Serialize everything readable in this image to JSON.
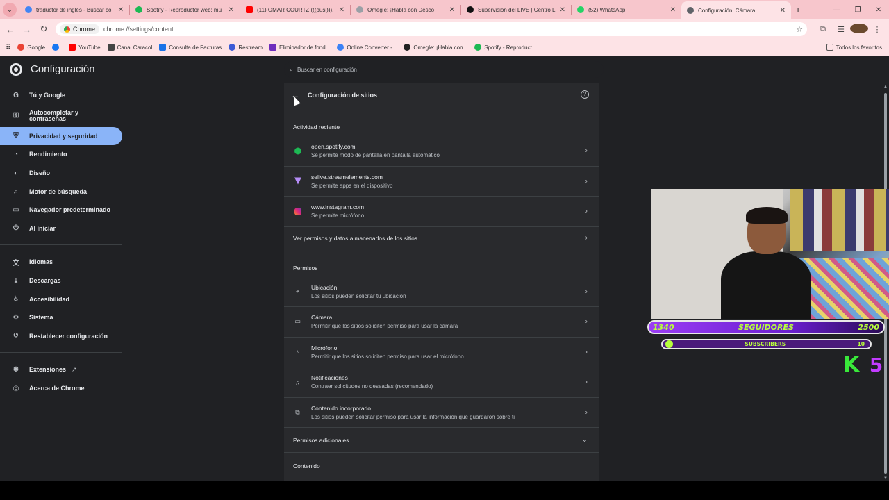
{
  "tabs": [
    {
      "title": "traductor de inglés - Buscar co",
      "fav_color": "#4285f4"
    },
    {
      "title": "Spotify - Reproductor web: mú",
      "fav_color": "#1db954"
    },
    {
      "title": "(11) OMAR COURTZ (((ousi))), ",
      "fav_color": "#ff0000"
    },
    {
      "title": "Omegle: ¡Habla con Desco",
      "fav_color": "#9aa0a6"
    },
    {
      "title": "Supervisión del LIVE | Centro L",
      "fav_color": "#111111"
    },
    {
      "title": "(52) WhatsApp",
      "fav_color": "#25d366"
    },
    {
      "title": "Configuración: Cámara",
      "fav_color": "#5f6368"
    }
  ],
  "toolbar": {
    "chip_label": "Chrome",
    "url": "chrome://settings/content"
  },
  "bookmarks": [
    {
      "label": "Google",
      "color": "#ea4335"
    },
    {
      "label": "",
      "color": "#1877f2"
    },
    {
      "label": "YouTube",
      "color": "#ff0000"
    },
    {
      "label": "Canal Caracol",
      "color": "#444444"
    },
    {
      "label": "Consulta de Facturas",
      "color": "#1a73e8"
    },
    {
      "label": "Restream",
      "color": "#3c5bd6"
    },
    {
      "label": "Eliminador de fond...",
      "color": "#6f2dbd"
    },
    {
      "label": "Online Converter -...",
      "color": "#3b82f6"
    },
    {
      "label": "Omegle: ¡Habla con...",
      "color": "#222222"
    },
    {
      "label": "Spotify - Reproduct...",
      "color": "#1db954"
    }
  ],
  "bookmarks_all": "Todos los favoritos",
  "settings": {
    "title": "Configuración",
    "search_placeholder": "Buscar en configuración"
  },
  "sidebar": {
    "items": [
      {
        "label": "Tú y Google",
        "icon": "G"
      },
      {
        "label": "Autocompletar y contraseñas",
        "icon": "⚿"
      },
      {
        "label": "Privacidad y seguridad",
        "icon": "⛨"
      },
      {
        "label": "Rendimiento",
        "icon": "◔"
      },
      {
        "label": "Diseño",
        "icon": "◐"
      },
      {
        "label": "Motor de búsqueda",
        "icon": "⌕"
      },
      {
        "label": "Navegador predeterminado",
        "icon": "▭"
      },
      {
        "label": "Al iniciar",
        "icon": "⏻"
      },
      {
        "label": "Idiomas",
        "icon": "文"
      },
      {
        "label": "Descargas",
        "icon": "⤓"
      },
      {
        "label": "Accesibilidad",
        "icon": "♿"
      },
      {
        "label": "Sistema",
        "icon": "⚙"
      },
      {
        "label": "Restablecer configuración",
        "icon": "↺"
      },
      {
        "label": "Extensiones",
        "icon": "✱"
      },
      {
        "label": "Acerca de Chrome",
        "icon": "◎"
      }
    ]
  },
  "site_settings": {
    "title": "Configuración de sitios",
    "recent_heading": "Actividad reciente",
    "recent": [
      {
        "site": "open.spotify.com",
        "desc": "Se permite modo de pantalla en pantalla automático",
        "color": "#1db954"
      },
      {
        "site": "selive.streamelements.com",
        "desc": "Se permite apps en el dispositivo",
        "color": "#8e5cf7"
      },
      {
        "site": "www.instagram.com",
        "desc": "Se permite micrófono",
        "color": "#e1306c"
      }
    ],
    "view_permissions": "Ver permisos y datos almacenados de los sitios",
    "permissions_heading": "Permisos",
    "permissions": [
      {
        "title": "Ubicación",
        "desc": "Los sitios pueden solicitar tu ubicación",
        "icon": "⌖"
      },
      {
        "title": "Cámara",
        "desc": "Permitir que los sitios soliciten permiso para usar la cámara",
        "icon": "▭"
      },
      {
        "title": "Micrófono",
        "desc": "Permitir que los sitios soliciten permiso para usar el micrófono",
        "icon": "🎙"
      },
      {
        "title": "Notificaciones",
        "desc": "Contraer solicitudes no deseadas (recomendado)",
        "icon": "🔔"
      },
      {
        "title": "Contenido incorporado",
        "desc": "Los sitios pueden solicitar permiso para usar la información que guardaron sobre ti",
        "icon": "⧉"
      }
    ],
    "additional_permissions": "Permisos adicionales",
    "content_heading": "Contenido"
  },
  "overlay": {
    "followers_current": "1340",
    "followers_label": "SEGUIDORES",
    "followers_goal": "2500",
    "subs_label": "SUBSCRIBERS",
    "subs_goal": "10",
    "badge_left": "K",
    "badge_right": "5"
  }
}
